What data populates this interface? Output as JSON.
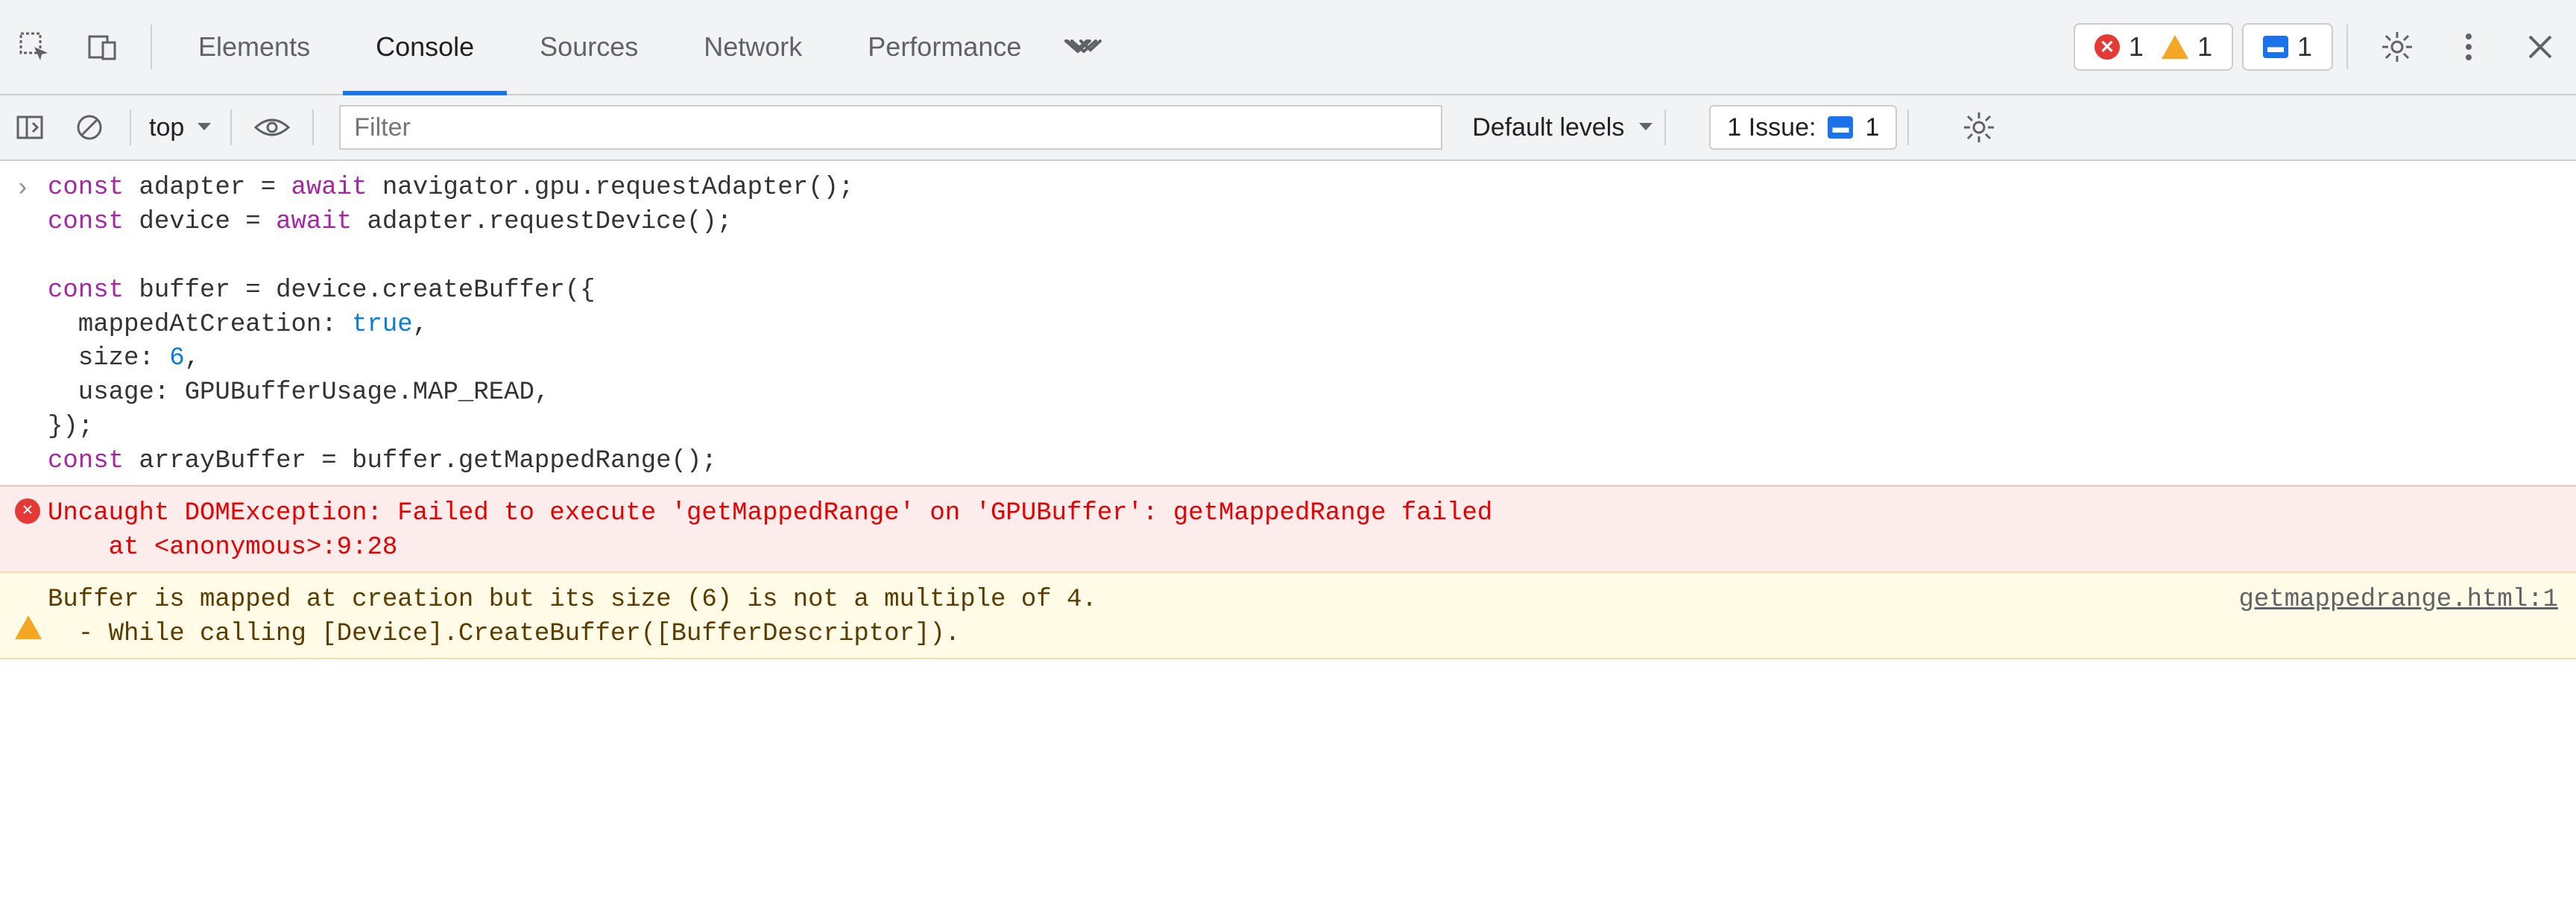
{
  "tabs": {
    "items": [
      "Elements",
      "Console",
      "Sources",
      "Network",
      "Performance"
    ],
    "active_index": 1
  },
  "status_counts": {
    "errors": "1",
    "warnings": "1",
    "info": "1"
  },
  "toolbar": {
    "context_label": "top",
    "filter_placeholder": "Filter",
    "levels_label": "Default levels",
    "issues_label": "1 Issue:",
    "issues_count": "1"
  },
  "console_input": {
    "line1_a": "const",
    "line1_b": " adapter = ",
    "line1_c": "await",
    "line1_d": " navigator.gpu.requestAdapter();",
    "line2_a": "const",
    "line2_b": " device = ",
    "line2_c": "await",
    "line2_d": " adapter.requestDevice();",
    "line3": "",
    "line4_a": "const",
    "line4_b": " buffer = device.createBuffer({",
    "line5_a": "  mappedAtCreation: ",
    "line5_b": "true",
    "line5_c": ",",
    "line6_a": "  size: ",
    "line6_b": "6",
    "line6_c": ",",
    "line7": "  usage: GPUBufferUsage.MAP_READ,",
    "line8": "});",
    "line9_a": "const",
    "line9_b": " arrayBuffer = buffer.getMappedRange();"
  },
  "error_message": {
    "line1": "Uncaught DOMException: Failed to execute 'getMappedRange' on 'GPUBuffer': getMappedRange failed",
    "line2": "    at <anonymous>:9:28"
  },
  "warn_message": {
    "line1": "Buffer is mapped at creation but its size (6) is not a multiple of 4.",
    "line2": "  - While calling [Device].CreateBuffer([BufferDescriptor]).",
    "source_link": "getmappedrange.html:1"
  }
}
